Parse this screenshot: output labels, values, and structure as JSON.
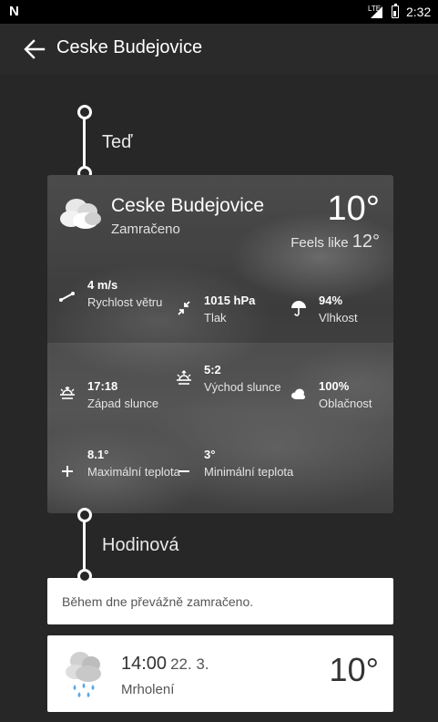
{
  "status_bar": {
    "logo": "N",
    "network": "LTE",
    "time": "2:32"
  },
  "app_bar": {
    "title": "Ceske Budejovice",
    "back_icon": "arrow-back-icon"
  },
  "sections": {
    "now_label": "Teď",
    "hourly_label": "Hodinová"
  },
  "current": {
    "city": "Ceske Budejovice",
    "condition": "Zamračeno",
    "temperature": "10°",
    "feels_like_label": "Feels like",
    "feels_like_value": "12°",
    "icon": "cloudy-icon",
    "stats": [
      {
        "id": "wind",
        "icon": "wind-icon",
        "value": "4 m/s",
        "label": "Rychlost větru"
      },
      {
        "id": "pressure",
        "icon": "pressure-icon",
        "value": "1015 hPa",
        "label": "Tlak"
      },
      {
        "id": "humidity",
        "icon": "umbrella-icon",
        "value": "94%",
        "label": "Vlhkost"
      },
      {
        "id": "sunset",
        "icon": "sunset-icon",
        "value": "17:18",
        "label": "Západ slunce"
      },
      {
        "id": "sunrise",
        "icon": "sunrise-icon",
        "value": "5:2",
        "label": "Východ slunce"
      },
      {
        "id": "cloudiness",
        "icon": "cloud-icon",
        "value": "100%",
        "label": "Oblačnost"
      },
      {
        "id": "max-temp",
        "icon": "plus-icon",
        "value": "8.1°",
        "label": "Maximální teplota"
      },
      {
        "id": "min-temp",
        "icon": "minus-icon",
        "value": "3°",
        "label": "Minimální teplota"
      }
    ]
  },
  "hourly": {
    "summary": "Během dne převážně zamračeno.",
    "items": [
      {
        "time": "14:00",
        "date": "22. 3.",
        "condition": "Mrholení",
        "temperature": "10°",
        "icon": "drizzle-icon"
      }
    ]
  },
  "colors": {
    "background": "#272727",
    "card": "#ffffff",
    "status_bar": "#000000"
  }
}
